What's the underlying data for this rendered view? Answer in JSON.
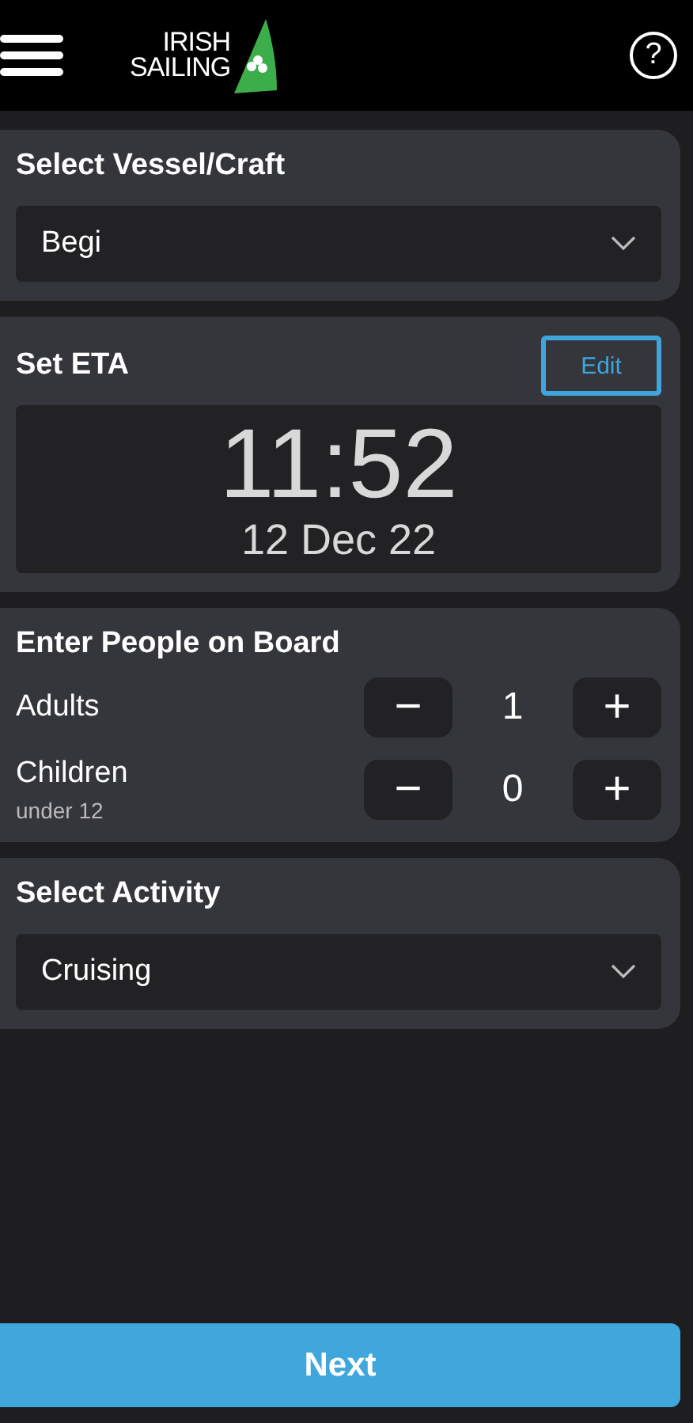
{
  "header": {
    "logo_lines": [
      "IRISH",
      "SAILING"
    ],
    "help": "?"
  },
  "vessel": {
    "title": "Select Vessel/Craft",
    "value": "Begi"
  },
  "eta": {
    "title": "Set ETA",
    "edit": "Edit",
    "time": "11:52",
    "date": "12 Dec 22"
  },
  "people": {
    "title": "Enter People on Board",
    "rows": [
      {
        "label": "Adults",
        "sublabel": "",
        "minus": "−",
        "count": "1",
        "plus": "+"
      },
      {
        "label": "Children",
        "sublabel": "under 12",
        "minus": "−",
        "count": "0",
        "plus": "+"
      }
    ]
  },
  "activity": {
    "title": "Select Activity",
    "value": "Cruising"
  },
  "next": "Next"
}
